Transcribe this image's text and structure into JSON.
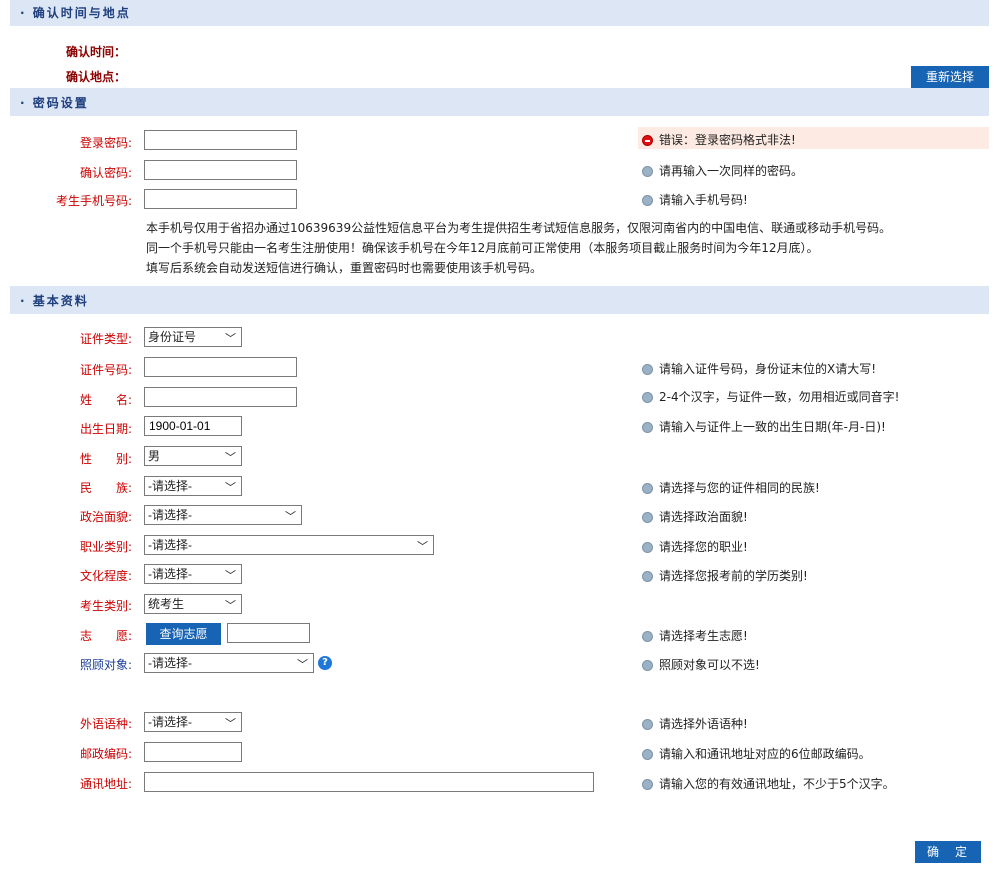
{
  "sections": {
    "confirm_title": "确认时间与地点",
    "password_title": "密码设置",
    "basic_title": "基本资料"
  },
  "confirm": {
    "time_label": "确认时间：",
    "place_label": "确认地点：",
    "reselect_button": "重新选择"
  },
  "password": {
    "login_label": "登录密码:",
    "login_value": "",
    "login_error": "错误：登录密码格式非法!",
    "confirm_label": "确认密码:",
    "confirm_value": "",
    "confirm_hint": "请再输入一次同样的密码。",
    "phone_label": "考生手机号码:",
    "phone_value": "",
    "phone_hint": "请输入手机号码!",
    "notes": [
      "本手机号仅用于省招办通过10639639公益性短信息平台为考生提供招生考试短信息服务，仅限河南省内的中国电信、联通或移动手机号码。",
      "同一个手机号只能由一名考生注册使用！确保该手机号在今年12月底前可正常使用（本服务项目截止服务时间为今年12月底）。",
      "填写后系统会自动发送短信进行确认，重置密码时也需要使用该手机号码。"
    ]
  },
  "basic": {
    "id_type_label": "证件类型:",
    "id_type_value": "身份证号",
    "id_no_label": "证件号码:",
    "id_no_value": "",
    "id_no_hint": "请输入证件号码，身份证末位的X请大写!",
    "name_label": "姓　　名:",
    "name_value": "",
    "name_hint": "2-4个汉字，与证件一致，勿用相近或同音字!",
    "birth_label": "出生日期:",
    "birth_value": "1900-01-01",
    "birth_hint": "请输入与证件上一致的出生日期(年-月-日)!",
    "gender_label": "性　　别:",
    "gender_value": "男",
    "ethnic_label": "民　　族:",
    "ethnic_value": "-请选择-",
    "ethnic_hint": "请选择与您的证件相同的民族!",
    "political_label": "政治面貌:",
    "political_value": "-请选择-",
    "political_hint": "请选择政治面貌!",
    "job_label": "职业类别:",
    "job_value": "-请选择-",
    "job_hint": "请选择您的职业!",
    "edu_label": "文化程度:",
    "edu_value": "-请选择-",
    "edu_hint": "请选择您报考前的学历类别!",
    "category_label": "考生类别:",
    "category_value": "统考生",
    "wish_label": "志　　愿:",
    "wish_button": "查询志愿",
    "wish_value": "",
    "wish_hint": "请选择考生志愿!",
    "care_label": "照顾对象:",
    "care_value": "-请选择-",
    "care_help": "?",
    "care_hint": "照顾对象可以不选!",
    "lang_label": "外语语种:",
    "lang_value": "-请选择-",
    "lang_hint": "请选择外语语种!",
    "zip_label": "邮政编码:",
    "zip_value": "",
    "zip_hint": "请输入和通讯地址对应的6位邮政编码。",
    "addr_label": "通讯地址:",
    "addr_value": "",
    "addr_hint": "请输入您的有效通讯地址，不少于5个汉字。"
  },
  "submit_button": "确　定",
  "colors": {
    "band": "#dce6f4",
    "label_red": "#cc0000",
    "button_blue": "#1763b4",
    "error_bg": "#fdebe3"
  }
}
